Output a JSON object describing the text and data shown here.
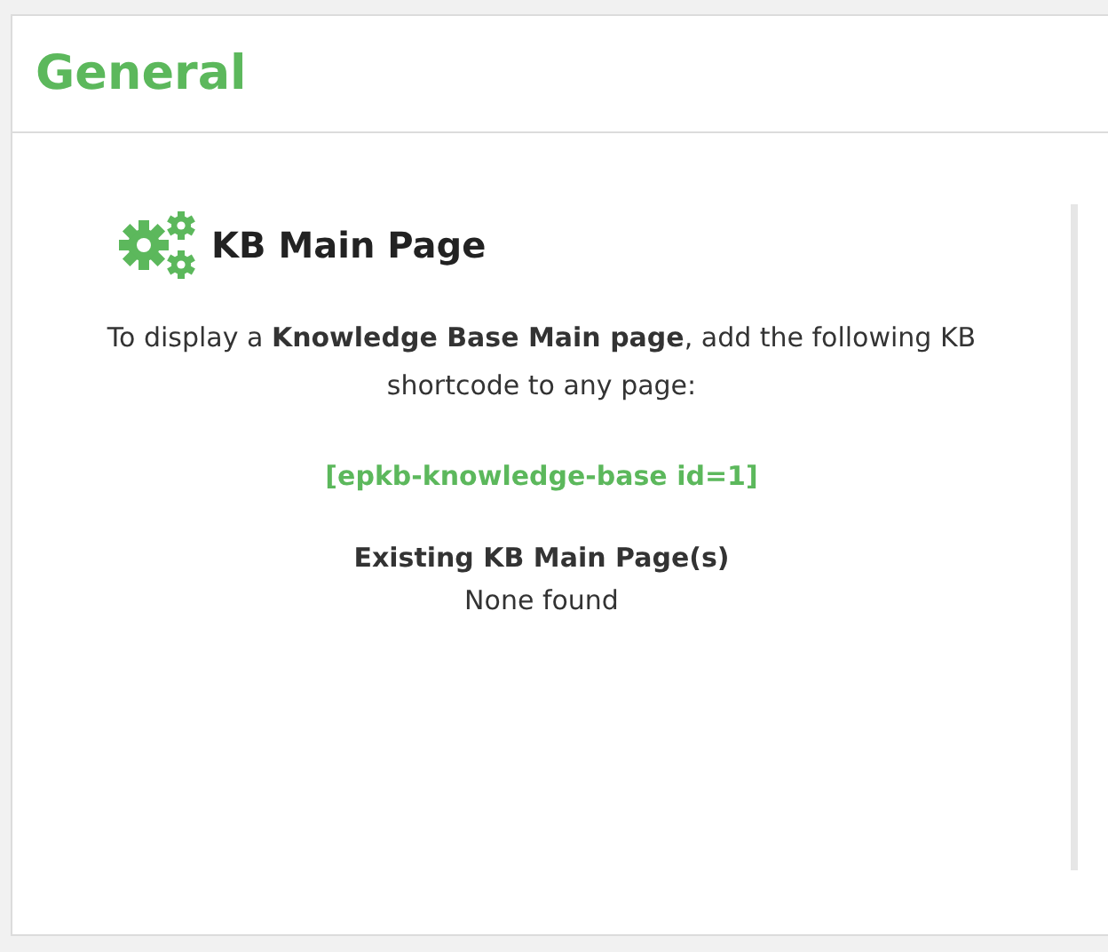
{
  "header": {
    "title": "General"
  },
  "card": {
    "title": "KB Main Page",
    "description": "To display a **Knowledge Base Main page**, add the following KB shortcode to any page:",
    "shortcode": "[epkb-knowledge-base id=1]",
    "existing_label": "Existing KB Main Page(s)",
    "existing_value": "None found"
  }
}
